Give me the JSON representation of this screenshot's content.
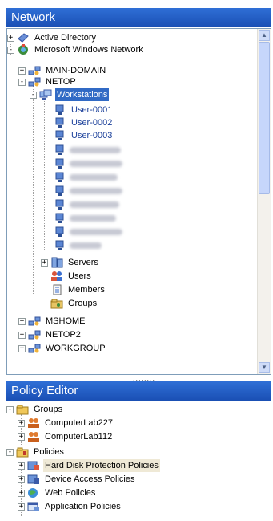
{
  "network": {
    "title": "Network",
    "nodes": [
      {
        "label": "Active Directory",
        "icon": "active-directory-icon",
        "expander": "+"
      },
      {
        "label": "Microsoft Windows Network",
        "icon": "windows-network-icon",
        "expander": "-"
      },
      {
        "label": "MAIN-DOMAIN",
        "icon": "domain-icon",
        "expander": "+"
      },
      {
        "label": "NETOP",
        "icon": "domain-icon",
        "expander": "-"
      },
      {
        "label": "Workstations",
        "icon": "workstations-icon",
        "expander": "-"
      },
      {
        "label": "User-0001",
        "icon": "computer-icon"
      },
      {
        "label": "User-0002",
        "icon": "computer-icon"
      },
      {
        "label": "User-0003",
        "icon": "computer-icon"
      },
      {
        "label": "Servers",
        "icon": "servers-icon",
        "expander": "+"
      },
      {
        "label": "Users",
        "icon": "users-icon"
      },
      {
        "label": "Members",
        "icon": "members-icon"
      },
      {
        "label": "Groups",
        "icon": "groups-icon"
      },
      {
        "label": "MSHOME",
        "icon": "domain-icon",
        "expander": "+"
      },
      {
        "label": "NETOP2",
        "icon": "domain-icon",
        "expander": "+"
      },
      {
        "label": "WORKGROUP",
        "icon": "domain-icon",
        "expander": "+"
      }
    ],
    "splitter": "........"
  },
  "policy": {
    "title": "Policy Editor",
    "nodes": [
      {
        "label": "Groups",
        "icon": "groups-folder-icon",
        "expander": "-"
      },
      {
        "label": "ComputerLab227",
        "icon": "group-icon",
        "expander": "+"
      },
      {
        "label": "ComputerLab112",
        "icon": "group-icon",
        "expander": "+"
      },
      {
        "label": "Policies",
        "icon": "policies-folder-icon",
        "expander": "-"
      },
      {
        "label": "Hard Disk Protection Policies",
        "icon": "hard-disk-policy-icon",
        "expander": "+"
      },
      {
        "label": "Device Access Policies",
        "icon": "device-policy-icon",
        "expander": "+"
      },
      {
        "label": "Web Policies",
        "icon": "web-policy-icon",
        "expander": "+"
      },
      {
        "label": "Application Policies",
        "icon": "application-policy-icon",
        "expander": "+"
      }
    ]
  },
  "colors": {
    "header": "#1a4fb4",
    "selection": "#316ac5",
    "highlight": "#efe9d6"
  }
}
